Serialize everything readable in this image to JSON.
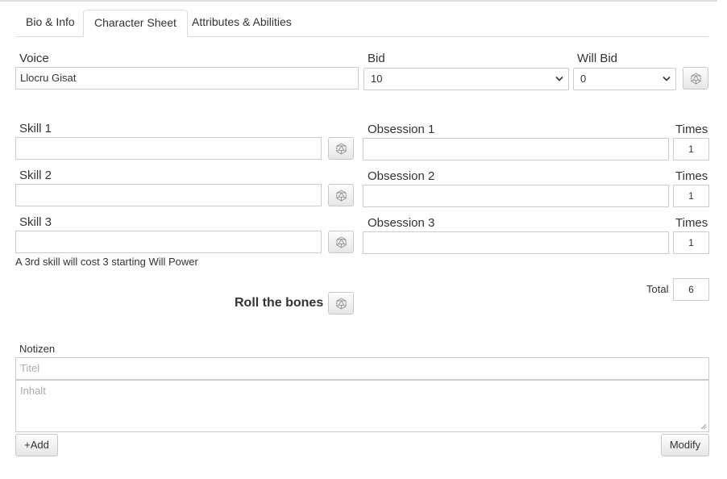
{
  "tabs": [
    "Bio & Info",
    "Character Sheet",
    "Attributes & Abilities"
  ],
  "voice": {
    "label": "Voice",
    "value": "Llocru Gisat"
  },
  "bid": {
    "label": "Bid",
    "value": "10"
  },
  "will_bid": {
    "label": "Will Bid",
    "value": "0"
  },
  "skills": [
    {
      "label": "Skill 1",
      "value": ""
    },
    {
      "label": "Skill 2",
      "value": ""
    },
    {
      "label": "Skill 3",
      "value": ""
    }
  ],
  "obsessions": [
    {
      "label": "Obsession 1",
      "value": "",
      "times_label": "Times",
      "times": "1"
    },
    {
      "label": "Obsession 2",
      "value": "",
      "times_label": "Times",
      "times": "1"
    },
    {
      "label": "Obsession 3",
      "value": "",
      "times_label": "Times",
      "times": "1"
    }
  ],
  "note_text": "A 3rd skill will cost 3 starting Will Power",
  "total": {
    "label": "Total",
    "value": "6"
  },
  "roll_label": "Roll the bones",
  "notes": {
    "label": "Notizen",
    "title_placeholder": "Titel",
    "content_placeholder": "Inhalt",
    "add_label": "+Add",
    "modify_label": "Modify"
  },
  "icons": {
    "dice": "dice-icon",
    "chevron": "chevron-down-icon"
  }
}
